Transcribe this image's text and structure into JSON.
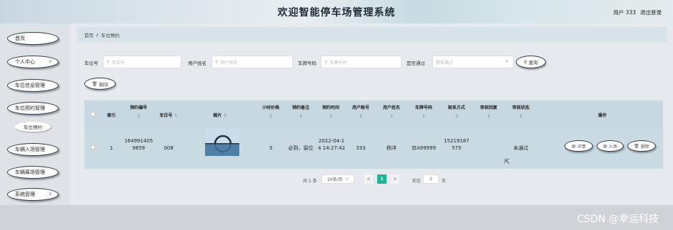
{
  "header": {
    "title": "欢迎智能停车场管理系统",
    "user": "用户 333",
    "logout": "退出登录"
  },
  "sidebar": {
    "items": [
      {
        "label": "首页",
        "has_chevron": false
      },
      {
        "label": "个人中心",
        "has_chevron": true
      },
      {
        "label": "车位信息管理",
        "has_chevron": false
      },
      {
        "label": "车位预约管理",
        "has_chevron": false
      },
      {
        "label": "车辆入场管理",
        "has_chevron": false
      },
      {
        "label": "车辆离场管理",
        "has_chevron": false
      },
      {
        "label": "系统管理",
        "has_chevron": true
      }
    ],
    "subitem": "车位预约",
    "chevron": "∨"
  },
  "breadcrumb": {
    "home": "首页",
    "sep": "/",
    "current": "车位预约"
  },
  "search": {
    "fields": [
      {
        "label": "车位号",
        "placeholder": "车位号"
      },
      {
        "label": "用户姓名",
        "placeholder": "用户姓名"
      },
      {
        "label": "车牌号码",
        "placeholder": "车牌号码"
      },
      {
        "label": "是否通过",
        "placeholder": "是否通过"
      }
    ],
    "query_button": "查询"
  },
  "actions": {
    "delete_button": "删除"
  },
  "table": {
    "headers": [
      "索引",
      "预约编号",
      "车位号",
      "图片",
      "小时价格",
      "预约备注",
      "预约时间",
      "用户账号",
      "用户姓名",
      "车牌号码",
      "联系方式",
      "审核回复",
      "审核状态",
      "操作"
    ],
    "sort_glyph": "⇕",
    "rows": [
      {
        "index": "1",
        "booking_no": "164991405\n9859",
        "space_no": "008",
        "hourly_price": "3",
        "remark": "必到，留位",
        "booking_time": "2022-04-1\n4 14:27:42",
        "account": "333",
        "user_name": "杨洋",
        "plate": "京A99999",
        "phone": "15219187\n575",
        "reply": "",
        "status": "未通过",
        "buttons": [
          "详情",
          "入场",
          "删除"
        ]
      }
    ]
  },
  "pagination": {
    "total": "共 1 条",
    "page_size": "10条/页",
    "current_page": "1",
    "goto_prefix": "前往",
    "goto_value": "1",
    "goto_suffix": "页"
  },
  "watermark": "CSDN @幸运科技"
}
